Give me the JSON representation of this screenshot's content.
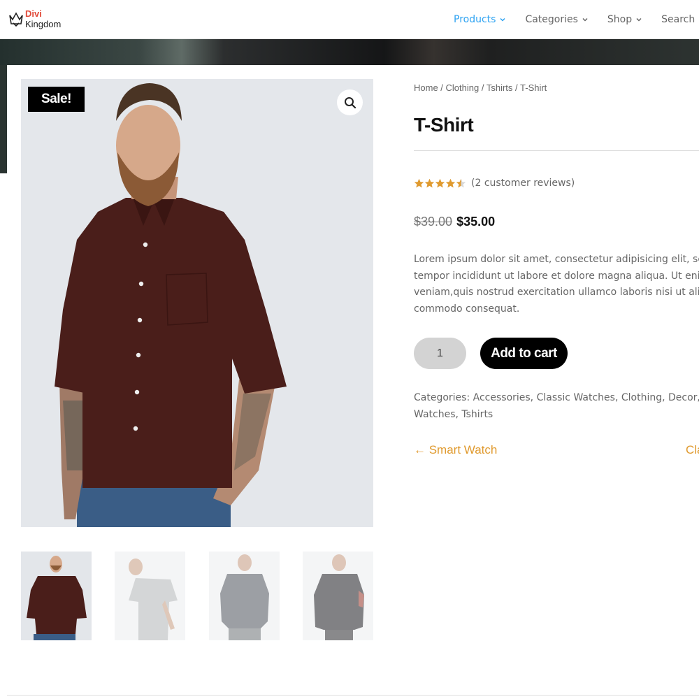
{
  "header": {
    "logo_line1": "Divi",
    "logo_line2": "Kingdom",
    "nav": [
      {
        "label": "Products",
        "active": true,
        "has_dropdown": true
      },
      {
        "label": "Categories",
        "active": false,
        "has_dropdown": true
      },
      {
        "label": "Shop",
        "active": false,
        "has_dropdown": true
      },
      {
        "label": "Search",
        "active": false,
        "has_dropdown": false
      }
    ]
  },
  "product": {
    "sale_badge": "Sale!",
    "breadcrumb": [
      "Home",
      "Clothing",
      "Tshirts",
      "T-Shirt"
    ],
    "breadcrumb_sep": " / ",
    "title": "T-Shirt",
    "rating": 4.5,
    "reviews_text": "(2 customer reviews)",
    "old_price": "$39.00",
    "new_price": "$35.00",
    "description_lines": [
      "Lorem ipsum dolor sit amet, consectetur adipisicing elit, sed d",
      "tempor incididunt ut labore et dolore magna aliqua. Ut enim",
      "veniam,quis nostrud exercitation ullamco laboris nisi ut aliqu",
      "commodo consequat."
    ],
    "quantity": "1",
    "add_to_cart": "Add to cart",
    "categories_label": "Categories:",
    "categories_line1": "Accessories, Classic Watches, Clothing, Decor, Hoo",
    "categories_line2": "Watches, Tshirts",
    "prev_product": "← Smart Watch",
    "next_product": "Cla"
  },
  "colors": {
    "nav_active": "#2ea3f2",
    "accent_link": "#e09a2e",
    "star": "#e09a2e",
    "shirt": "#4a1e1a"
  },
  "icons": {
    "zoom": "magnifier-icon",
    "logo": "crown-icon",
    "nav_dropdown": "chevron-down-icon"
  }
}
